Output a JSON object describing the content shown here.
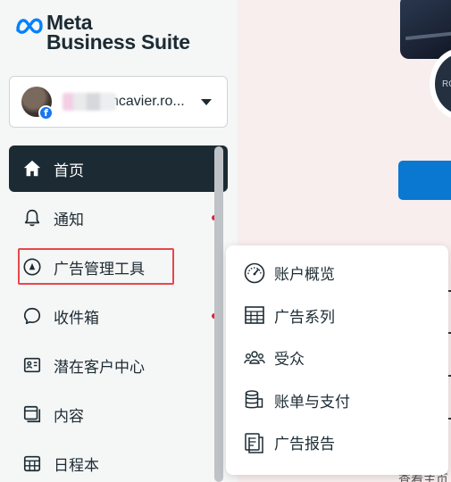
{
  "brand": {
    "line1": "Meta",
    "line2": "Business Suite",
    "logo_icon": "meta-infinity-logo",
    "color": "#0082fb"
  },
  "account": {
    "name": "hcavier.ro...",
    "badge_icon": "facebook-icon",
    "badge_text": "f",
    "dropdown_icon": "caret-down-icon"
  },
  "nav": {
    "items": [
      {
        "label": "首页",
        "icon": "home-icon",
        "active": true
      },
      {
        "label": "通知",
        "icon": "bell-icon",
        "badge": true
      },
      {
        "label": "广告管理工具",
        "icon": "ads-manager-icon"
      },
      {
        "label": "收件箱",
        "icon": "chat-bubble-icon",
        "badge": true
      },
      {
        "label": "潜在客户中心",
        "icon": "contact-card-icon"
      },
      {
        "label": "内容",
        "icon": "content-icon"
      },
      {
        "label": "日程本",
        "icon": "calendar-icon"
      }
    ]
  },
  "flyout": {
    "items": [
      {
        "label": "账户概览",
        "icon": "gauge-icon"
      },
      {
        "label": "广告系列",
        "icon": "table-icon"
      },
      {
        "label": "受众",
        "icon": "people-icon"
      },
      {
        "label": "账单与支付",
        "icon": "coins-icon"
      },
      {
        "label": "广告报告",
        "icon": "report-icon"
      }
    ]
  },
  "main": {
    "profile_initials": "RO",
    "bottom_text": "查看主页"
  },
  "colors": {
    "active_bg": "#1c2b33",
    "highlight": "#e8474a",
    "notification_dot": "#e41e3f",
    "primary_button": "#0a78d1"
  }
}
